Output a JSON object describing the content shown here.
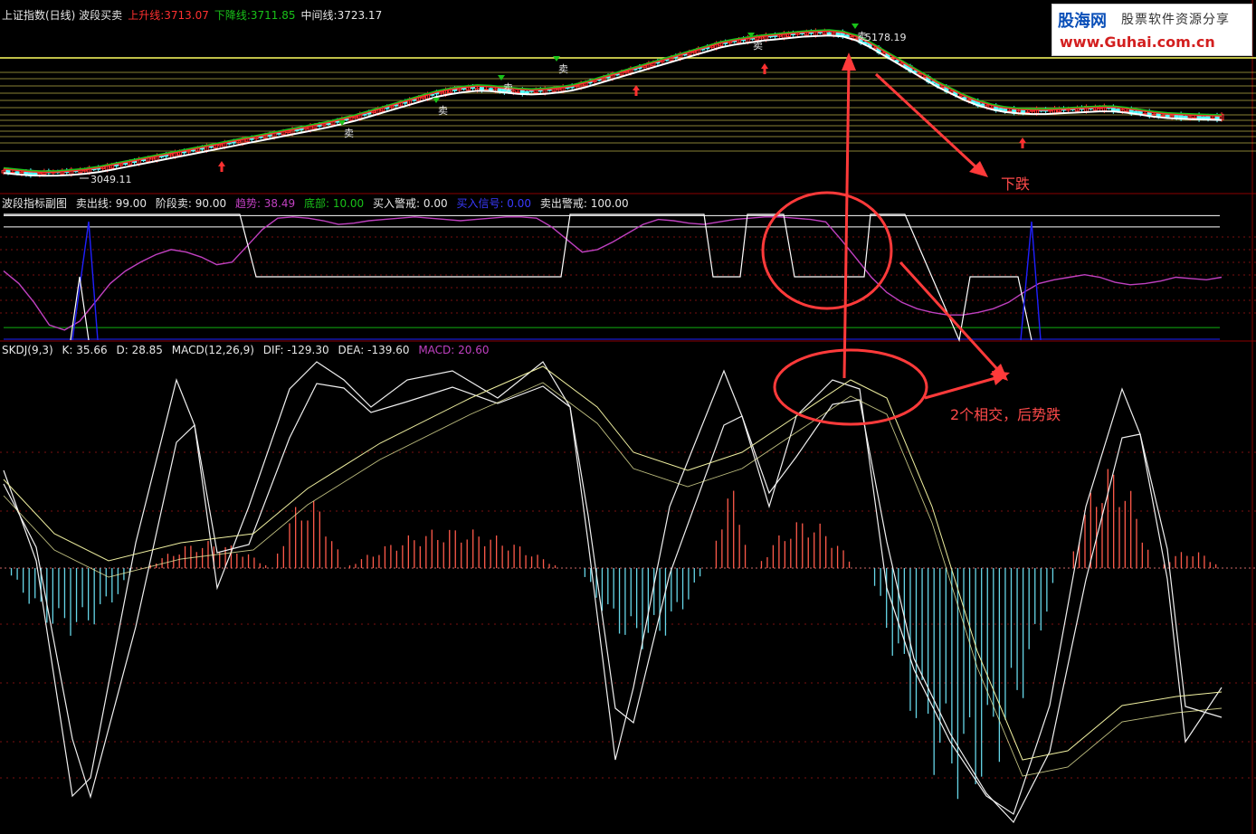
{
  "colors": {
    "background": "#000000",
    "panel_border": "#8b0000",
    "grid_dash": "#7a1010",
    "price_line_white": "#ffffff",
    "ma_green": "#19c219",
    "ma_red": "#ff3030",
    "ma_yellow": "#e5d800",
    "candle_up": "#ff3030",
    "candle_down": "#54ffff",
    "buy_signal_red": "#ff3030",
    "sell_signal_green": "#19c219",
    "indicator_magenta": "#c040c0",
    "indicator_white": "#ffffff",
    "indicator_blue": "#2020ff",
    "indicator_green": "#10b010",
    "kdj_line": "#f0f0f0",
    "dif_dea_yellow": "#f0f0a0",
    "macd_pos": "#ff5a4a",
    "macd_neg": "#66d6e8",
    "annotation_red": "#ff3a3a"
  },
  "header_main": {
    "title": "上证指数(日线) 波段买卖",
    "up_label": "上升线:",
    "up_value": "3713.07",
    "down_label": "下降线:",
    "down_value": "3711.85",
    "mid_label": "中间线:",
    "mid_value": "3723.17"
  },
  "header_sub": {
    "title": "波段指标副图",
    "sell_line": "卖出线: 99.00",
    "stage_sell": "阶段卖: 90.00",
    "trend": "趋势: 38.49",
    "bottom": "底部: 10.00",
    "buy_warn": "买入警戒: 0.00",
    "buy_signal": "买入信号: 0.00",
    "sell_warn": "卖出警戒: 100.00"
  },
  "header_macd": {
    "skdj": "SKDJ(9,3)",
    "k": "K: 35.66",
    "d": "D: 28.85",
    "macd_params": "MACD(12,26,9)",
    "dif": "DIF: -129.30",
    "dea": "DEA: -139.60",
    "macd": "MACD: 20.60"
  },
  "logo": {
    "cn": "股海网",
    "cn_sub": "股票软件资源分享",
    "url": "www.Guhai.com.cn"
  },
  "annotations": {
    "fall": "下跌",
    "cross": "2个相交，后势跌",
    "peak": "5178.19",
    "low": "3049.11",
    "sell_tag": "卖"
  },
  "chart_data": [
    {
      "type": "line",
      "title": "上证指数(日线) 波段买卖",
      "series": [
        {
          "name": "上升线",
          "values": [
            3100,
            3080,
            3060,
            3050,
            3055,
            3070,
            3090,
            3120,
            3160,
            3200,
            3240,
            3280,
            3320,
            3360,
            3400,
            3440,
            3480,
            3520,
            3560,
            3600,
            3640,
            3680,
            3720,
            3760,
            3800,
            3850,
            3900,
            3960,
            4020,
            4080,
            4140,
            4200,
            4260,
            4300,
            4330,
            4350,
            4340,
            4320,
            4300,
            4290,
            4300,
            4320,
            4350,
            4400,
            4460,
            4520,
            4580,
            4640,
            4700,
            4760,
            4820,
            4880,
            4940,
            5000,
            5040,
            5070,
            5100,
            5120,
            5140,
            5160,
            5170,
            5178,
            5160,
            5100,
            5000,
            4880,
            4760,
            4640,
            4520,
            4400,
            4300,
            4200,
            4120,
            4060,
            4020,
            4000,
            3990,
            3990,
            4000,
            4010,
            4020,
            4030,
            4030,
            4010,
            3980,
            3950,
            3930,
            3920,
            3910,
            3905,
            3900
          ]
        },
        {
          "name": "中间线",
          "values": [
            3090,
            3070,
            3055,
            3049,
            3052,
            3062,
            3080,
            3105,
            3140,
            3180,
            3220,
            3260,
            3300,
            3340,
            3380,
            3420,
            3460,
            3500,
            3540,
            3580,
            3620,
            3660,
            3700,
            3740,
            3780,
            3830,
            3880,
            3940,
            4000,
            4060,
            4120,
            4180,
            4240,
            4280,
            4310,
            4330,
            4325,
            4305,
            4285,
            4275,
            4285,
            4305,
            4335,
            4385,
            4445,
            4505,
            4565,
            4625,
            4685,
            4745,
            4805,
            4865,
            4925,
            4985,
            5025,
            5055,
            5085,
            5105,
            5125,
            5145,
            5155,
            5165,
            5150,
            5090,
            4990,
            4870,
            4750,
            4630,
            4510,
            4390,
            4290,
            4190,
            4110,
            4050,
            4010,
            3990,
            3980,
            3980,
            3990,
            4000,
            4010,
            4020,
            4020,
            4000,
            3970,
            3940,
            3920,
            3910,
            3900,
            3895,
            3890
          ]
        }
      ],
      "signals": [
        "卖",
        "卖",
        "卖",
        "卖",
        "卖",
        "卖"
      ],
      "peak_label": "5178.19",
      "low_label": "3049.11"
    },
    {
      "type": "line",
      "title": "波段指标副图",
      "series": [
        {
          "name": "趋势",
          "values": [
            55,
            45,
            30,
            12,
            8,
            15,
            30,
            45,
            55,
            62,
            68,
            72,
            70,
            66,
            60,
            62,
            75,
            88,
            97,
            98,
            97,
            95,
            92,
            93,
            95,
            96,
            97,
            98,
            97,
            96,
            95,
            96,
            97,
            98,
            98,
            97,
            90,
            80,
            70,
            72,
            78,
            85,
            92,
            96,
            95,
            93,
            92,
            94,
            96,
            97,
            98,
            98,
            97,
            96,
            94,
            80,
            65,
            50,
            38,
            30,
            25,
            22,
            20,
            20,
            22,
            25,
            30,
            38,
            45,
            48,
            50,
            52,
            50,
            46,
            44,
            45,
            47,
            50,
            49,
            48,
            50
          ]
        },
        {
          "name": "卖出线",
          "values": [
            99
          ]
        },
        {
          "name": "阶段卖",
          "values": [
            90
          ]
        },
        {
          "name": "底部",
          "values": [
            10
          ]
        }
      ]
    },
    {
      "type": "line",
      "title": "SKDJ(9,3) MACD(12,26,9)",
      "k": "35.66",
      "d": "28.85",
      "dif": "-129.30",
      "dea": "-139.60",
      "macd": "20.60"
    }
  ]
}
